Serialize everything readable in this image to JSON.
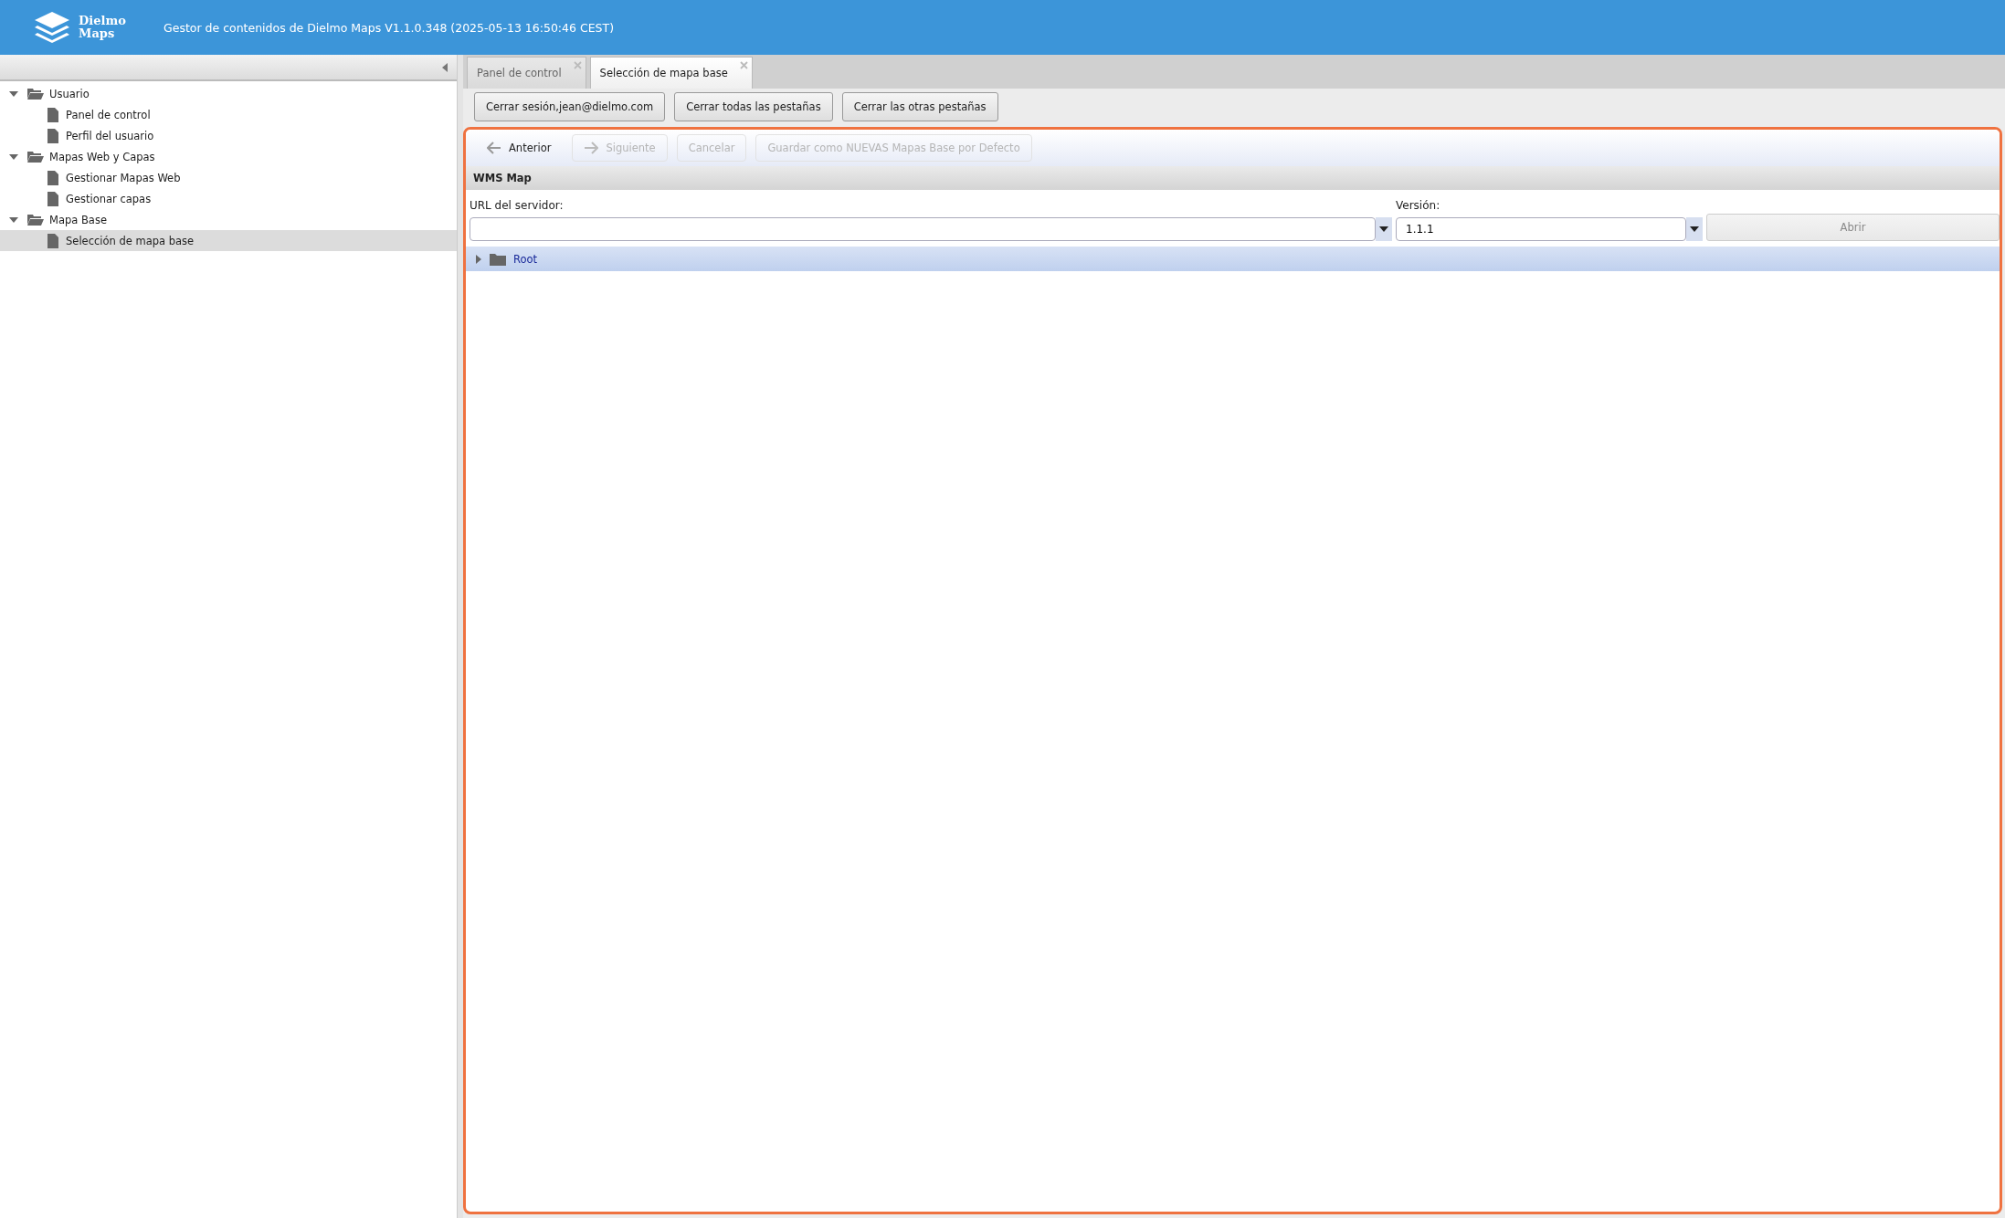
{
  "header": {
    "logo_lines": [
      "Dielmo",
      "Maps"
    ],
    "title": "Gestor de contenidos de Dielmo Maps V1.1.0.348 (2025-05-13 16:50:46 CEST)"
  },
  "sidebar": {
    "items": [
      {
        "label": "Usuario",
        "expanded": true,
        "selected": false,
        "children": [
          {
            "label": "Panel de control",
            "selected": false
          },
          {
            "label": "Perfil del usuario",
            "selected": false
          }
        ]
      },
      {
        "label": "Mapas Web y Capas",
        "expanded": true,
        "selected": false,
        "children": [
          {
            "label": "Gestionar Mapas Web",
            "selected": false
          },
          {
            "label": "Gestionar capas",
            "selected": false
          }
        ]
      },
      {
        "label": "Mapa Base",
        "expanded": true,
        "selected": false,
        "children": [
          {
            "label": "Selección de mapa base",
            "selected": true
          }
        ]
      }
    ]
  },
  "tabs": [
    {
      "label": "Panel de control",
      "selected": false
    },
    {
      "label": "Selección de mapa base",
      "selected": true
    }
  ],
  "session_buttons": [
    "Cerrar sesión,jean@dielmo.com",
    "Cerrar todas las pestañas",
    "Cerrar las otras pestañas"
  ],
  "wizard_toolbar": [
    {
      "label": "Anterior",
      "kind": "back",
      "disabled": false
    },
    {
      "label": "Siguiente",
      "kind": "next",
      "disabled": true
    },
    {
      "label": "Cancelar",
      "kind": "plain",
      "disabled": true
    },
    {
      "label": "Guardar como NUEVAS Mapas Base por Defecto",
      "kind": "plain",
      "disabled": true
    }
  ],
  "section_title": "WMS Map",
  "form": {
    "url_label": "URL del servidor:",
    "version_label": "Versión:",
    "version_value": "1.1.1",
    "open_button": {
      "label": "Abrir",
      "disabled": true
    }
  },
  "layer_tree": [
    {
      "label": "Root",
      "expanded": false,
      "selected": true
    }
  ]
}
